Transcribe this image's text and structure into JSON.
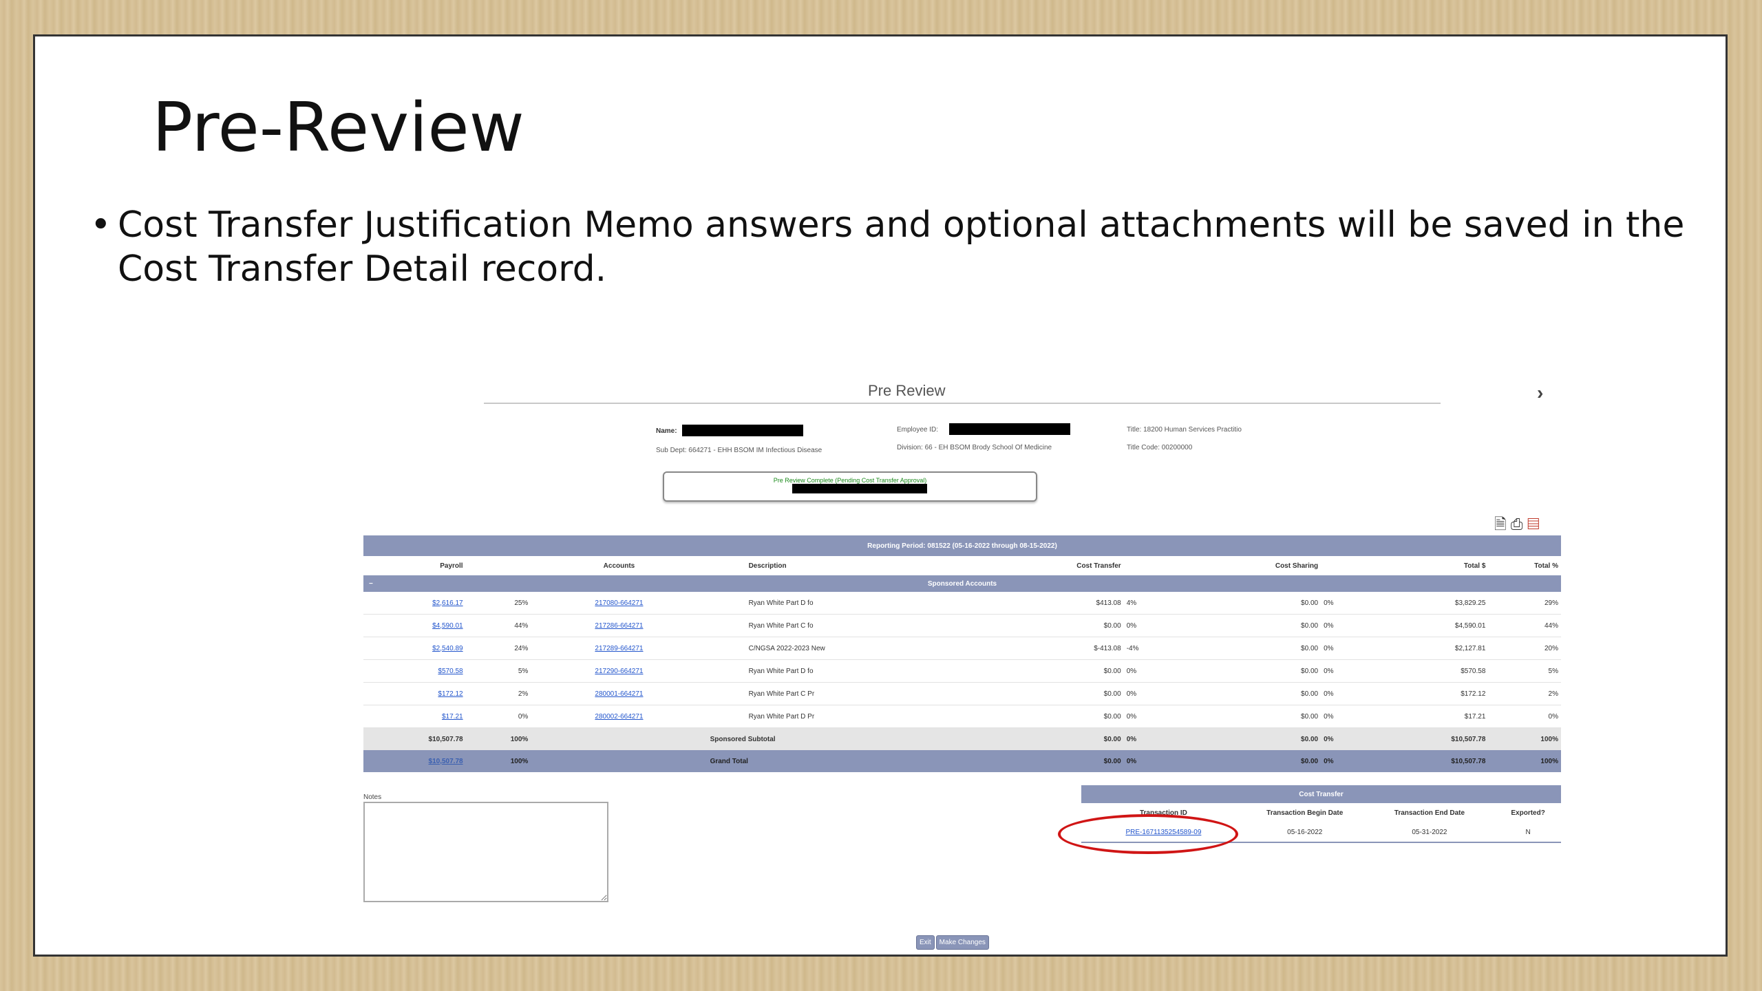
{
  "slide": {
    "title": "Pre-Review",
    "bullet": "Cost Transfer Justification Memo answers and optional attachments will be saved in the Cost Transfer Detail record.",
    "bullet_symbol": "•"
  },
  "screenshot": {
    "page_title": "Pre Review",
    "next_icon": "chevron-right-icon",
    "employee": {
      "name_label": "Name:",
      "sub_dept": "Sub Dept: 664271 - EHH BSOM IM Infectious Disease",
      "employee_id_label": "Employee ID:",
      "division": "Division: 66 - EH BSOM Brody School Of Medicine",
      "title": "Title: 18200 Human Services Practitio",
      "title_code": "Title Code: 00200000"
    },
    "status": "Pre Review Complete (Pending Cost Transfer Approval)",
    "action_icons": [
      "history-icon",
      "print-icon",
      "pdf-icon"
    ],
    "reporting_period": "Reporting Period: 081522 (05-16-2022 through 08-15-2022)",
    "columns": [
      "Payroll",
      "Accounts",
      "Description",
      "Cost Transfer",
      "Cost Sharing",
      "Total $",
      "Total %"
    ],
    "section": {
      "toggle": "−",
      "label": "Sponsored Accounts"
    },
    "rows": [
      {
        "payroll": "$2,616.17",
        "pct": "25%",
        "account": "217080-664271",
        "description": "Ryan White Part D fo",
        "ct": "$413.08",
        "ct_pct": "4%",
        "cs": "$0.00",
        "cs_pct": "0%",
        "total": "$3,829.25",
        "total_pct": "29%"
      },
      {
        "payroll": "$4,590.01",
        "pct": "44%",
        "account": "217286-664271",
        "description": "Ryan White Part C fo",
        "ct": "$0.00",
        "ct_pct": "0%",
        "cs": "$0.00",
        "cs_pct": "0%",
        "total": "$4,590.01",
        "total_pct": "44%"
      },
      {
        "payroll": "$2,540.89",
        "pct": "24%",
        "account": "217289-664271",
        "description": "C/NGSA 2022-2023 New",
        "ct": "$-413.08",
        "ct_pct": "-4%",
        "cs": "$0.00",
        "cs_pct": "0%",
        "total": "$2,127.81",
        "total_pct": "20%"
      },
      {
        "payroll": "$570.58",
        "pct": "5%",
        "account": "217290-664271",
        "description": "Ryan White Part D fo",
        "ct": "$0.00",
        "ct_pct": "0%",
        "cs": "$0.00",
        "cs_pct": "0%",
        "total": "$570.58",
        "total_pct": "5%"
      },
      {
        "payroll": "$172.12",
        "pct": "2%",
        "account": "280001-664271",
        "description": "Ryan White Part C Pr",
        "ct": "$0.00",
        "ct_pct": "0%",
        "cs": "$0.00",
        "cs_pct": "0%",
        "total": "$172.12",
        "total_pct": "2%"
      },
      {
        "payroll": "$17.21",
        "pct": "0%",
        "account": "280002-664271",
        "description": "Ryan White Part D Pr",
        "ct": "$0.00",
        "ct_pct": "0%",
        "cs": "$0.00",
        "cs_pct": "0%",
        "total": "$17.21",
        "total_pct": "0%"
      }
    ],
    "subtotal": {
      "payroll": "$10,507.78",
      "pct": "100%",
      "label": "Sponsored Subtotal",
      "ct": "$0.00",
      "ct_pct": "0%",
      "cs": "$0.00",
      "cs_pct": "0%",
      "total": "$10,507.78",
      "total_pct": "100%"
    },
    "grand_total": {
      "payroll": "$10,507.78",
      "pct": "100%",
      "label": "Grand Total",
      "ct": "$0.00",
      "ct_pct": "0%",
      "cs": "$0.00",
      "cs_pct": "0%",
      "total": "$10,507.78",
      "total_pct": "100%"
    },
    "notes_label": "Notes",
    "cost_transfer": {
      "title": "Cost Transfer",
      "columns": [
        "Transaction ID",
        "Transaction Begin Date",
        "Transaction End Date",
        "Exported?"
      ],
      "row": {
        "id": "PRE-1671135254589-09",
        "begin": "05-16-2022",
        "end": "05-31-2022",
        "exported": "N"
      }
    },
    "buttons": {
      "exit": "Exit",
      "make_changes": "Make Changes"
    },
    "colors": {
      "header_blue": "#8a95b8",
      "status_green": "#1a8a1a",
      "highlight_red": "#d01515"
    }
  }
}
